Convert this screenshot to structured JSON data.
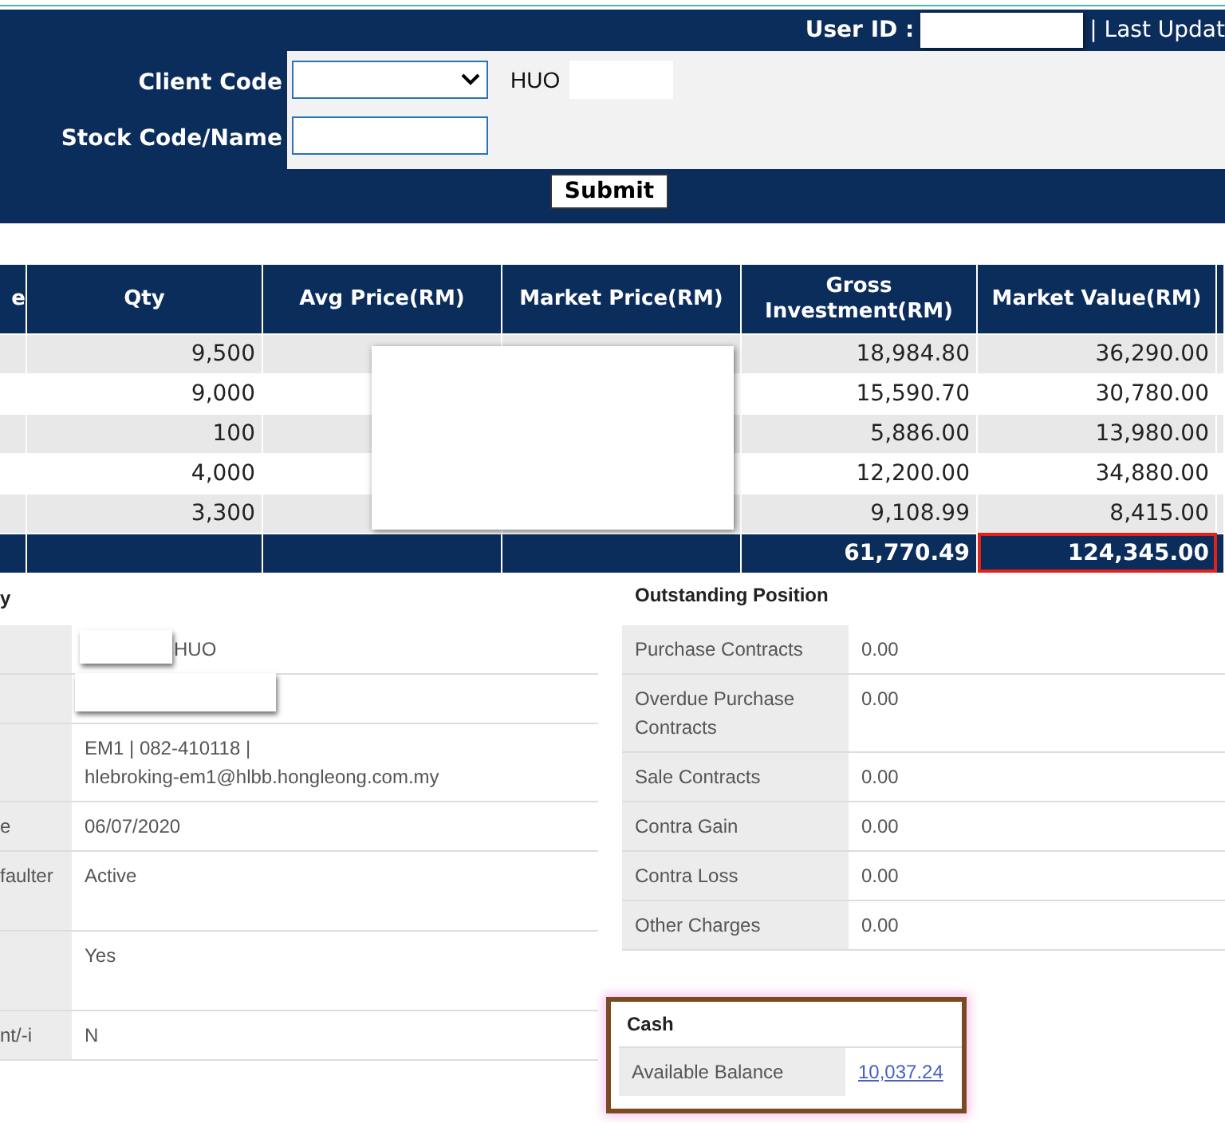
{
  "header": {
    "user_id_label": "User ID :",
    "user_id_redacted": true,
    "last_update_label": "| Last Updat"
  },
  "form": {
    "fields": [
      {
        "kind": "select",
        "label": "Client Code",
        "suffix": "HUO",
        "suffix_redacted": true
      },
      {
        "kind": "text",
        "label": "Stock Code/Name"
      }
    ],
    "submit": "Submit"
  },
  "holdings": {
    "columns": [
      "e",
      "Qty",
      "Avg Price(RM)",
      "Market Price(RM)",
      "Gross Investment(RM)",
      "Market Value(RM)"
    ],
    "prices_redacted": true,
    "rows": [
      {
        "qty": "9,500",
        "gross": "18,984.80",
        "value": "36,290.00"
      },
      {
        "qty": "9,000",
        "gross": "15,590.70",
        "value": "30,780.00"
      },
      {
        "qty": "100",
        "gross": "5,886.00",
        "value": "13,980.00"
      },
      {
        "qty": "4,000",
        "gross": "12,200.00",
        "value": "34,880.00"
      },
      {
        "qty": "3,300",
        "gross": "9,108.99",
        "value": "8,415.00"
      }
    ],
    "total": {
      "gross": "61,770.49",
      "value": "124,345.00",
      "highlighted": true
    }
  },
  "account": {
    "title": "y",
    "rows": [
      {
        "value": "HUO",
        "redacted": true
      },
      {
        "redacted": true
      },
      {
        "value": "EM1 | 082-410118 |\nhlebroking-em1@hlbb.hongleong.com.my"
      },
      {
        "label": "e",
        "value": "06/07/2020"
      },
      {
        "label": "faulter",
        "value": "Active"
      },
      {
        "value": "Yes"
      },
      {
        "label": "nt/-i",
        "value": "N"
      }
    ]
  },
  "outstanding": {
    "title": "Outstanding Position",
    "rows": [
      {
        "label": "Purchase Contracts",
        "value": "0.00"
      },
      {
        "label": "Overdue Purchase Contracts",
        "value": "0.00"
      },
      {
        "label": "Sale Contracts",
        "value": "0.00"
      },
      {
        "label": "Contra Gain",
        "value": "0.00"
      },
      {
        "label": "Contra Loss",
        "value": "0.00"
      },
      {
        "label": "Other Charges",
        "value": "0.00"
      }
    ]
  },
  "cash": {
    "title": "Cash",
    "highlighted": true,
    "rows": [
      {
        "kind": "link",
        "label": "Available Balance",
        "value": "10,037.24"
      }
    ]
  }
}
